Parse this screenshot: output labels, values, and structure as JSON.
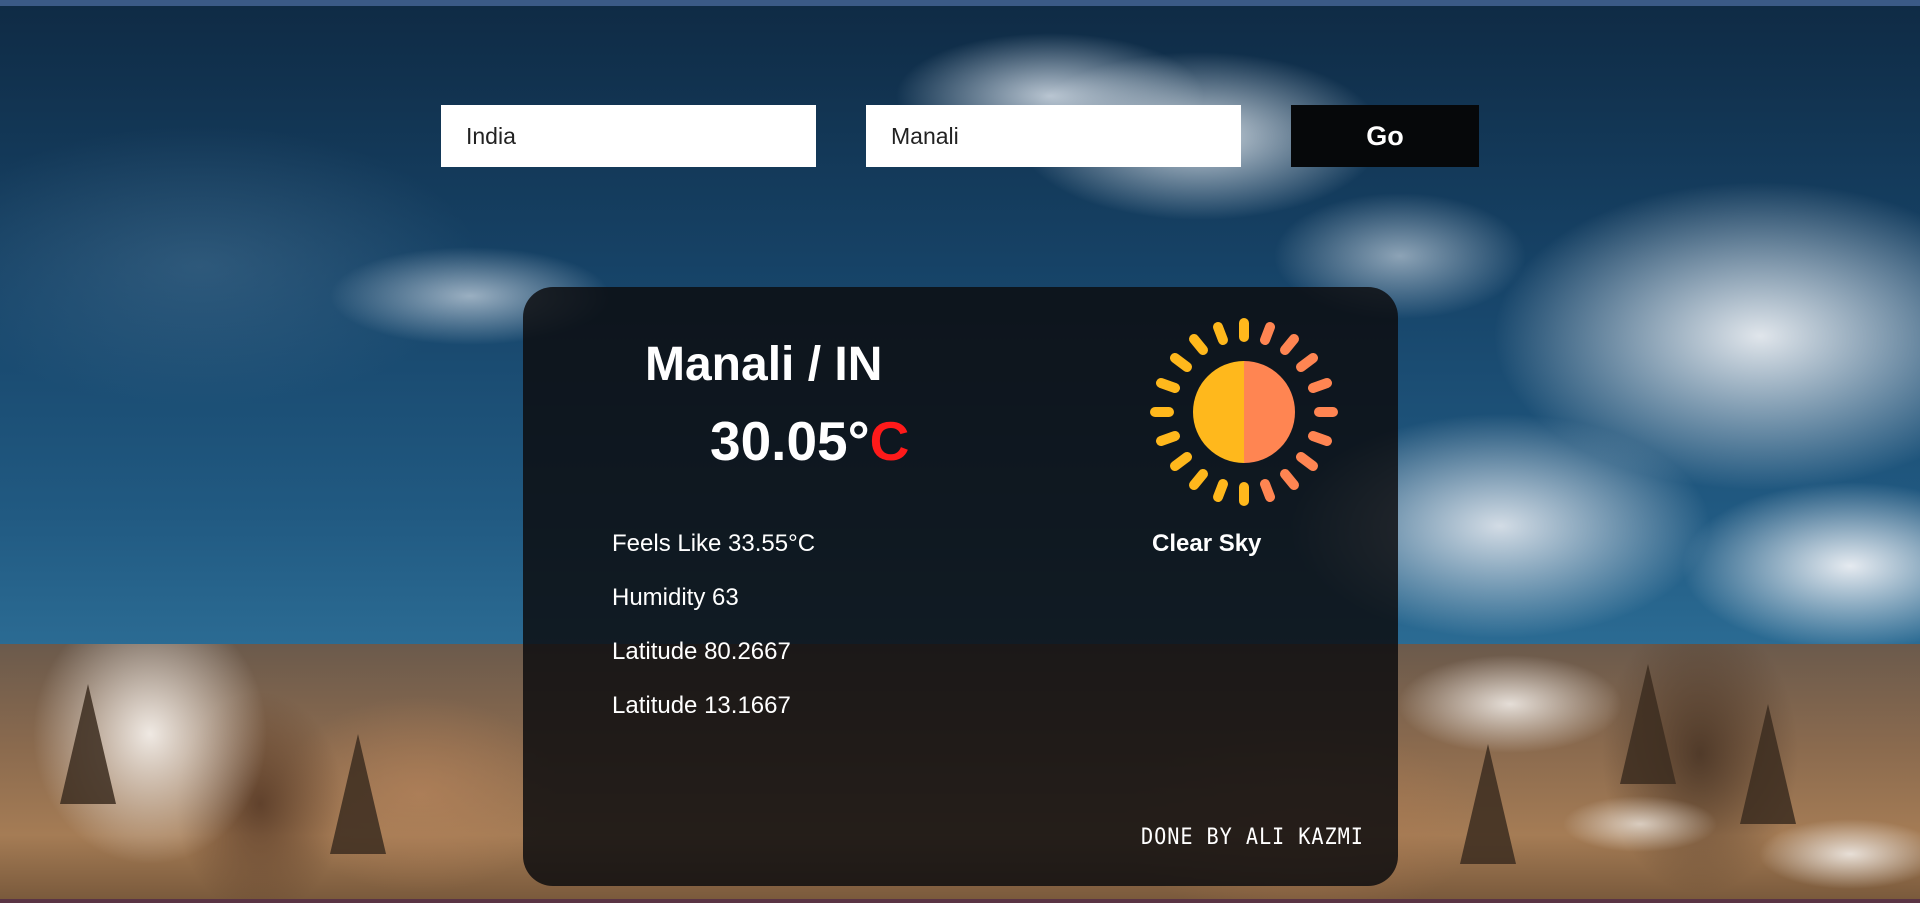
{
  "search": {
    "country_value": "India",
    "city_value": "Manali",
    "go_label": "Go"
  },
  "weather": {
    "location": "Manali / IN",
    "temperature_value": "30.05°",
    "temperature_unit": "C",
    "condition": "Clear Sky",
    "condition_icon": "sun-icon",
    "feels_like": "Feels Like 33.55°C",
    "humidity": "Humidity 63",
    "latitude": "Latitude 80.2667",
    "longitude": "Latitude 13.1667"
  },
  "footer": {
    "credit": "DONE BY ALI KAZMI"
  },
  "colors": {
    "card_background": "#0c0c0e",
    "unit_accent": "#ff1a1a",
    "button_background": "#06080a",
    "sun_left": "#ffb81c",
    "sun_right": "#ff8552"
  }
}
